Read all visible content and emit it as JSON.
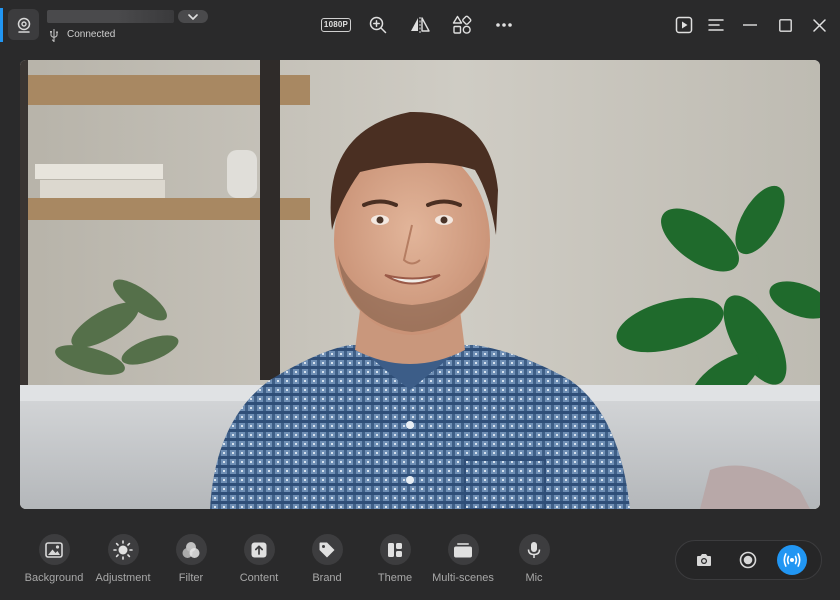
{
  "titlebar": {
    "device_name": "",
    "connection_status": "Connected",
    "resolution_badge": "1080P"
  },
  "toolbar": {
    "items": [
      {
        "label": "Background",
        "icon": "image-icon"
      },
      {
        "label": "Adjustment",
        "icon": "brightness-icon"
      },
      {
        "label": "Filter",
        "icon": "filter-circles-icon"
      },
      {
        "label": "Content",
        "icon": "upload-icon"
      },
      {
        "label": "Brand",
        "icon": "tag-icon"
      },
      {
        "label": "Theme",
        "icon": "layout-icon"
      },
      {
        "label": "Multi-scenes",
        "icon": "scenes-icon"
      },
      {
        "label": "Mic",
        "icon": "microphone-icon"
      }
    ]
  },
  "actions": {
    "icons": [
      "camera-icon",
      "record-icon",
      "broadcast-icon"
    ],
    "live_color": "#2196f3"
  },
  "colors": {
    "background": "#2a2a2b",
    "accent": "#2196f3",
    "tool_circle": "#3d3d3f",
    "label": "#a8a8a8"
  }
}
